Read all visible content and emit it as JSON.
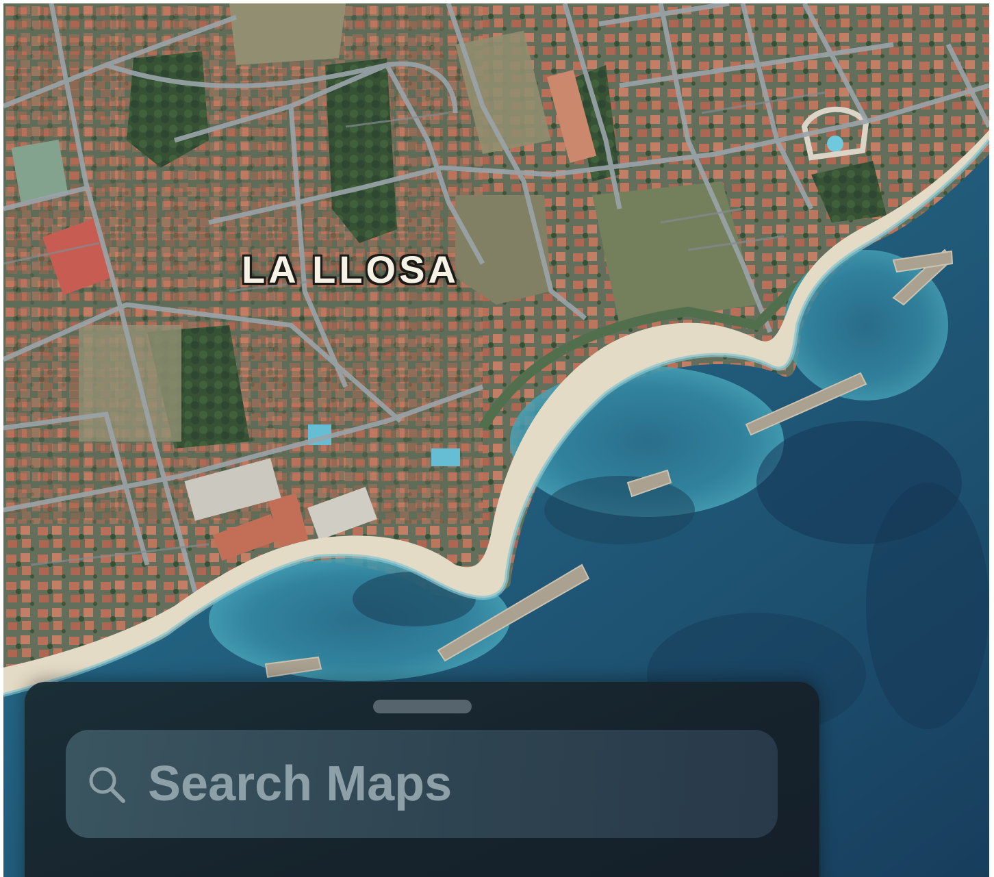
{
  "map": {
    "view": "satellite",
    "place_label": "LA LLOSA",
    "colors": {
      "sea_deep": "#0f3a5a",
      "sea_shallow": "#2a7a93",
      "beach_sand": "#e4dcc8",
      "land": "#5a6650",
      "roofs": "#b8684f",
      "vegetation": "#2f4a2c",
      "roads": "#8f99a0"
    }
  },
  "search_sheet": {
    "placeholder": "Search Maps",
    "icon": "magnifying-glass-icon",
    "grabber": "sheet-grabber-handle"
  }
}
